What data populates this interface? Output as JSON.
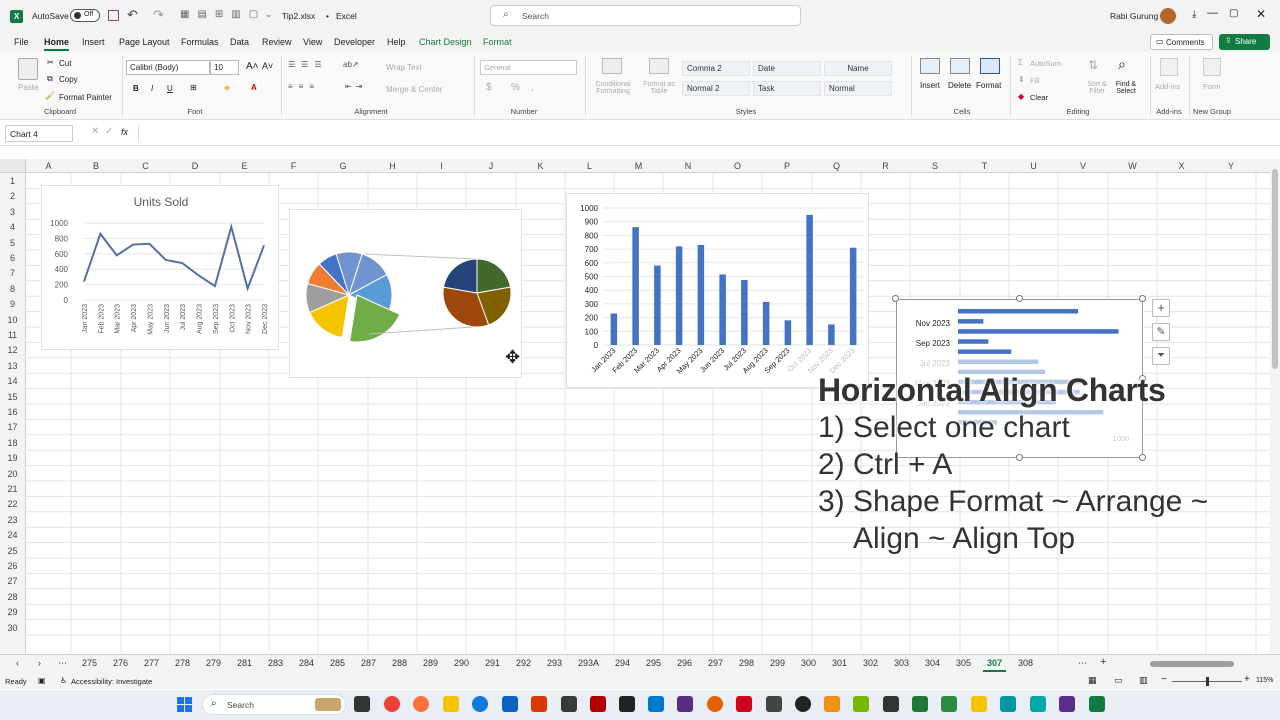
{
  "titlebar": {
    "autosave_label": "AutoSave",
    "autosave_state": "Off",
    "filename": "Tip2.xlsx",
    "app": "Excel",
    "title_sep": "•",
    "search_placeholder": "Search",
    "user_name": "Rabi Gurung"
  },
  "menu_tabs": [
    "File",
    "Home",
    "Insert",
    "Page Layout",
    "Formulas",
    "Data",
    "Review",
    "View",
    "Developer",
    "Help",
    "Chart Design",
    "Format"
  ],
  "active_tab": "Home",
  "comments_label": "Comments",
  "share_label": "Share",
  "clipboard": {
    "paste": "Paste",
    "cut": "Cut",
    "copy": "Copy",
    "format_painter": "Format Painter",
    "group": "Clipboard"
  },
  "font": {
    "name": "Calibri (Body)",
    "size": "10",
    "group": "Font",
    "bold": "B",
    "italic": "I",
    "underline": "U"
  },
  "alignment": {
    "wrap": "Wrap Text",
    "merge": "Merge & Center",
    "group": "Alignment"
  },
  "number": {
    "format": "General",
    "group": "Number",
    "currency": "$",
    "percent": "%",
    "comma": ","
  },
  "styles": {
    "conditional": "Conditional Formatting",
    "format_table": "Format as Table",
    "cells": [
      "Comma 2",
      "Date",
      "Name",
      "Normal 2",
      "Task",
      "Normal"
    ],
    "group": "Styles"
  },
  "cells_group": {
    "insert": "Insert",
    "delete": "Delete",
    "format": "Format",
    "group": "Cells"
  },
  "editing": {
    "autosum": "AutoSum",
    "fill": "Fill",
    "clear": "Clear",
    "sort": "Sort & Filter",
    "find": "Find & Select",
    "group": "Editing"
  },
  "addins": {
    "label": "Add-ins",
    "group": "Add-ins"
  },
  "newgroup": {
    "label": "Form",
    "group": "New Group"
  },
  "name_box": "Chart 4",
  "fx": "fx",
  "columns": [
    "A",
    "B",
    "C",
    "D",
    "E",
    "F",
    "G",
    "H",
    "I",
    "J",
    "K",
    "L",
    "M",
    "N",
    "O",
    "P",
    "Q",
    "R",
    "S",
    "T",
    "U",
    "V",
    "W",
    "X",
    "Y"
  ],
  "rows": [
    "1",
    "2",
    "3",
    "4",
    "5",
    "6",
    "7",
    "8",
    "9",
    "10",
    "11",
    "12",
    "13",
    "14",
    "15",
    "16",
    "17",
    "18",
    "19",
    "20",
    "21",
    "22",
    "23",
    "24",
    "25",
    "26",
    "27",
    "28",
    "29",
    "30"
  ],
  "chart_data": [
    {
      "type": "line",
      "title": "Units Sold",
      "categories": [
        "Jan 2023",
        "Feb 2023",
        "Mar 2023",
        "Apr 2023",
        "May 2023",
        "Jun 2023",
        "Jul 2023",
        "Aug 2023",
        "Sep 2023",
        "Oct 2023",
        "Nov 2023",
        "Dec 2023"
      ],
      "values": [
        240,
        860,
        580,
        720,
        730,
        520,
        480,
        320,
        180,
        950,
        150,
        710
      ],
      "yticks": [
        "1000",
        "800",
        "600",
        "400",
        "200",
        "0"
      ],
      "ylim": [
        0,
        1000
      ],
      "color": "#4f71a8"
    },
    {
      "type": "pie",
      "values": [
        13,
        9,
        7,
        6,
        8,
        10,
        12,
        17,
        4,
        6,
        4,
        4
      ],
      "colors": [
        "#f5c400",
        "#9e9e9e",
        "#ed7d31",
        "#4472c4",
        "#6f93d0",
        "#6f93d0",
        "#5b9bd5",
        "#70ad47",
        "#264478",
        "#9e480e",
        "#806000",
        "#43682b"
      ]
    },
    {
      "type": "bar",
      "categories": [
        "Jan 2023",
        "Feb 2023",
        "Mar 2023",
        "Apr 2023",
        "May 2023",
        "Jun 2023",
        "Jul 2023",
        "Aug 2023",
        "Sep 2023",
        "Oct 2023",
        "Nov 2023",
        "Dec 2023"
      ],
      "values": [
        230,
        860,
        580,
        720,
        730,
        515,
        475,
        315,
        180,
        950,
        150,
        710
      ],
      "yticks": [
        "1000",
        "900",
        "800",
        "700",
        "600",
        "500",
        "400",
        "300",
        "200",
        "100",
        "0"
      ],
      "ylim": [
        0,
        1000
      ],
      "color": "#4472c4"
    },
    {
      "type": "bar",
      "orientation": "horizontal",
      "categories_visible": [
        "Nov 2023",
        "Sep 2023",
        "Jul 2023",
        "May 2023",
        "Jan 2023"
      ],
      "values": [
        710,
        150,
        950,
        180,
        315,
        475,
        515,
        730,
        720,
        580,
        860,
        230
      ],
      "axis_label": "1000",
      "color": "#4472c4"
    }
  ],
  "overlay": {
    "heading": "Horizontal Align Charts",
    "step1": "1) Select one chart",
    "step2": "2) Ctrl + A",
    "step3": "3) Shape Format ~ Arrange ~",
    "step3b": "Align ~ Align Top"
  },
  "sheet_tabs": [
    "275",
    "276",
    "277",
    "278",
    "279",
    "281",
    "283",
    "284",
    "285",
    "287",
    "288",
    "289",
    "290",
    "291",
    "292",
    "293",
    "293A",
    "294",
    "295",
    "296",
    "297",
    "298",
    "299",
    "300",
    "301",
    "302",
    "303",
    "304",
    "305",
    "307",
    "308"
  ],
  "active_sheet": "307",
  "status": {
    "ready": "Ready",
    "accessibility": "Accessibility: Investigate",
    "zoom": "115%"
  },
  "taskbar": {
    "search": "Search"
  }
}
